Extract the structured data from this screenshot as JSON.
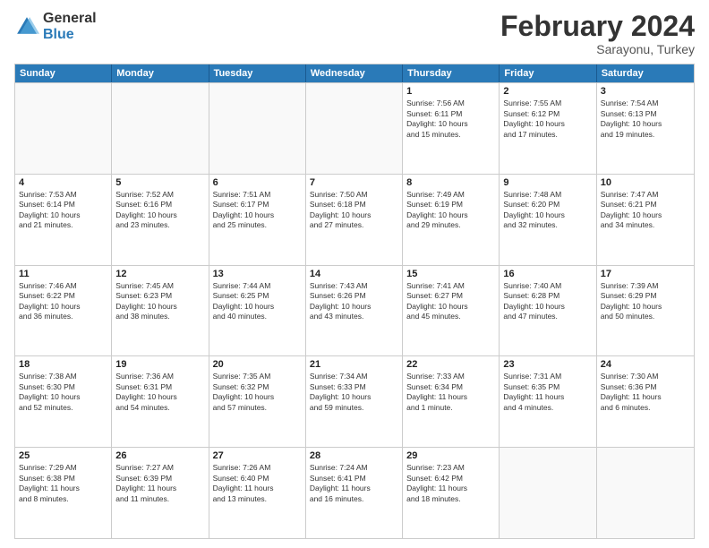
{
  "logo": {
    "general": "General",
    "blue": "Blue"
  },
  "title": "February 2024",
  "subtitle": "Sarayonu, Turkey",
  "header_days": [
    "Sunday",
    "Monday",
    "Tuesday",
    "Wednesday",
    "Thursday",
    "Friday",
    "Saturday"
  ],
  "weeks": [
    [
      {
        "day": "",
        "info": ""
      },
      {
        "day": "",
        "info": ""
      },
      {
        "day": "",
        "info": ""
      },
      {
        "day": "",
        "info": ""
      },
      {
        "day": "1",
        "info": "Sunrise: 7:56 AM\nSunset: 6:11 PM\nDaylight: 10 hours\nand 15 minutes."
      },
      {
        "day": "2",
        "info": "Sunrise: 7:55 AM\nSunset: 6:12 PM\nDaylight: 10 hours\nand 17 minutes."
      },
      {
        "day": "3",
        "info": "Sunrise: 7:54 AM\nSunset: 6:13 PM\nDaylight: 10 hours\nand 19 minutes."
      }
    ],
    [
      {
        "day": "4",
        "info": "Sunrise: 7:53 AM\nSunset: 6:14 PM\nDaylight: 10 hours\nand 21 minutes."
      },
      {
        "day": "5",
        "info": "Sunrise: 7:52 AM\nSunset: 6:16 PM\nDaylight: 10 hours\nand 23 minutes."
      },
      {
        "day": "6",
        "info": "Sunrise: 7:51 AM\nSunset: 6:17 PM\nDaylight: 10 hours\nand 25 minutes."
      },
      {
        "day": "7",
        "info": "Sunrise: 7:50 AM\nSunset: 6:18 PM\nDaylight: 10 hours\nand 27 minutes."
      },
      {
        "day": "8",
        "info": "Sunrise: 7:49 AM\nSunset: 6:19 PM\nDaylight: 10 hours\nand 29 minutes."
      },
      {
        "day": "9",
        "info": "Sunrise: 7:48 AM\nSunset: 6:20 PM\nDaylight: 10 hours\nand 32 minutes."
      },
      {
        "day": "10",
        "info": "Sunrise: 7:47 AM\nSunset: 6:21 PM\nDaylight: 10 hours\nand 34 minutes."
      }
    ],
    [
      {
        "day": "11",
        "info": "Sunrise: 7:46 AM\nSunset: 6:22 PM\nDaylight: 10 hours\nand 36 minutes."
      },
      {
        "day": "12",
        "info": "Sunrise: 7:45 AM\nSunset: 6:23 PM\nDaylight: 10 hours\nand 38 minutes."
      },
      {
        "day": "13",
        "info": "Sunrise: 7:44 AM\nSunset: 6:25 PM\nDaylight: 10 hours\nand 40 minutes."
      },
      {
        "day": "14",
        "info": "Sunrise: 7:43 AM\nSunset: 6:26 PM\nDaylight: 10 hours\nand 43 minutes."
      },
      {
        "day": "15",
        "info": "Sunrise: 7:41 AM\nSunset: 6:27 PM\nDaylight: 10 hours\nand 45 minutes."
      },
      {
        "day": "16",
        "info": "Sunrise: 7:40 AM\nSunset: 6:28 PM\nDaylight: 10 hours\nand 47 minutes."
      },
      {
        "day": "17",
        "info": "Sunrise: 7:39 AM\nSunset: 6:29 PM\nDaylight: 10 hours\nand 50 minutes."
      }
    ],
    [
      {
        "day": "18",
        "info": "Sunrise: 7:38 AM\nSunset: 6:30 PM\nDaylight: 10 hours\nand 52 minutes."
      },
      {
        "day": "19",
        "info": "Sunrise: 7:36 AM\nSunset: 6:31 PM\nDaylight: 10 hours\nand 54 minutes."
      },
      {
        "day": "20",
        "info": "Sunrise: 7:35 AM\nSunset: 6:32 PM\nDaylight: 10 hours\nand 57 minutes."
      },
      {
        "day": "21",
        "info": "Sunrise: 7:34 AM\nSunset: 6:33 PM\nDaylight: 10 hours\nand 59 minutes."
      },
      {
        "day": "22",
        "info": "Sunrise: 7:33 AM\nSunset: 6:34 PM\nDaylight: 11 hours\nand 1 minute."
      },
      {
        "day": "23",
        "info": "Sunrise: 7:31 AM\nSunset: 6:35 PM\nDaylight: 11 hours\nand 4 minutes."
      },
      {
        "day": "24",
        "info": "Sunrise: 7:30 AM\nSunset: 6:36 PM\nDaylight: 11 hours\nand 6 minutes."
      }
    ],
    [
      {
        "day": "25",
        "info": "Sunrise: 7:29 AM\nSunset: 6:38 PM\nDaylight: 11 hours\nand 8 minutes."
      },
      {
        "day": "26",
        "info": "Sunrise: 7:27 AM\nSunset: 6:39 PM\nDaylight: 11 hours\nand 11 minutes."
      },
      {
        "day": "27",
        "info": "Sunrise: 7:26 AM\nSunset: 6:40 PM\nDaylight: 11 hours\nand 13 minutes."
      },
      {
        "day": "28",
        "info": "Sunrise: 7:24 AM\nSunset: 6:41 PM\nDaylight: 11 hours\nand 16 minutes."
      },
      {
        "day": "29",
        "info": "Sunrise: 7:23 AM\nSunset: 6:42 PM\nDaylight: 11 hours\nand 18 minutes."
      },
      {
        "day": "",
        "info": ""
      },
      {
        "day": "",
        "info": ""
      }
    ]
  ]
}
